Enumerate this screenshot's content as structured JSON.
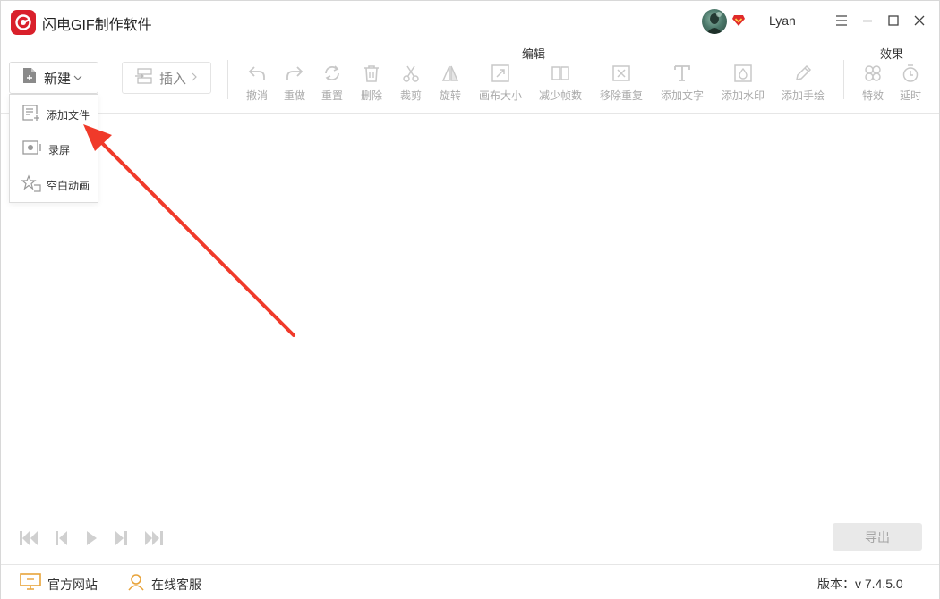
{
  "app": {
    "title": "闪电GIF制作软件",
    "accent": "#d9202b"
  },
  "user": {
    "name": "Lyan",
    "vip_color": "#e02a2a"
  },
  "toolbar": {
    "new_label": "新建",
    "insert_label": "插入",
    "edit_group_label": "编辑",
    "effects_group_label": "效果",
    "edit_tools": [
      {
        "label": "撤消",
        "icon": "undo-icon"
      },
      {
        "label": "重做",
        "icon": "redo-icon"
      },
      {
        "label": "重置",
        "icon": "reset-icon"
      },
      {
        "label": "删除",
        "icon": "delete-icon"
      },
      {
        "label": "裁剪",
        "icon": "scissors-icon"
      },
      {
        "label": "旋转",
        "icon": "rotate-icon"
      },
      {
        "label": "画布大小",
        "icon": "canvas-size-icon"
      },
      {
        "label": "减少帧数",
        "icon": "reduce-frames-icon"
      },
      {
        "label": "移除重复",
        "icon": "remove-duplicate-icon"
      },
      {
        "label": "添加文字",
        "icon": "add-text-icon"
      },
      {
        "label": "添加水印",
        "icon": "add-watermark-icon"
      },
      {
        "label": "添加手绘",
        "icon": "add-drawing-icon"
      }
    ],
    "effect_tools": [
      {
        "label": "特效",
        "icon": "effects-icon"
      },
      {
        "label": "延时",
        "icon": "timer-icon"
      }
    ]
  },
  "dropdown": {
    "items": [
      {
        "label": "添加文件",
        "icon": "add-file-icon"
      },
      {
        "label": "录屏",
        "icon": "screen-record-icon"
      },
      {
        "label": "空白动画",
        "icon": "blank-animation-icon"
      }
    ]
  },
  "player": {
    "export_label": "导出"
  },
  "status": {
    "website_label": "官方网站",
    "support_label": "在线客服",
    "version_text": "版本：v 7.4.5.0"
  },
  "annotation": {
    "arrow_color": "#f03a2a"
  }
}
